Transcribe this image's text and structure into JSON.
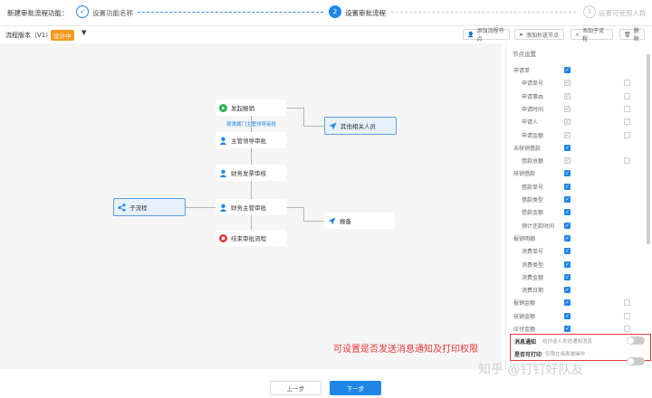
{
  "header": {
    "app_title": "新建审批流程功能：",
    "steps": [
      {
        "num": "✓",
        "label": "设置功能名称"
      },
      {
        "num": "2",
        "label": "设置审批流程"
      },
      {
        "num": "3",
        "label": "设置可使用人群"
      }
    ]
  },
  "toolbar": {
    "version_label": "流程版本（V1）",
    "version_status": "设计中",
    "buttons": [
      "添加流程节点",
      "添加抄送节点",
      "添加子流程",
      "删除"
    ]
  },
  "flow": {
    "nodes": {
      "start": "发起报销",
      "condition": "按隶属门主管领导审批",
      "notify_others": "其他相关人员",
      "supervisor": "主管领导审批",
      "finance_invoice": "财务发票审核",
      "subprocess": "子流程",
      "finance_supervisor": "财务主管审批",
      "report": "报备",
      "end": "结束审批流程"
    }
  },
  "panel": {
    "title": "节点设置",
    "fields": [
      {
        "label": "申请单",
        "indent": false,
        "read": "on",
        "write": "none"
      },
      {
        "label": "申请单号",
        "indent": true,
        "read": "dis",
        "write": "off"
      },
      {
        "label": "申请事由",
        "indent": true,
        "read": "dis",
        "write": "off"
      },
      {
        "label": "申请时间",
        "indent": true,
        "read": "dis",
        "write": "off"
      },
      {
        "label": "申请人",
        "indent": true,
        "read": "dis",
        "write": "off"
      },
      {
        "label": "申请金额",
        "indent": true,
        "read": "dis",
        "write": "off"
      },
      {
        "label": "未核销借款",
        "indent": false,
        "read": "on",
        "write": "none"
      },
      {
        "label": "借款总额",
        "indent": true,
        "read": "dis",
        "write": "off"
      },
      {
        "label": "核销借款",
        "indent": false,
        "read": "on",
        "write": "none"
      },
      {
        "label": "借款单号",
        "indent": true,
        "read": "on",
        "write": "none"
      },
      {
        "label": "借款类型",
        "indent": true,
        "read": "on",
        "write": "none"
      },
      {
        "label": "借款金额",
        "indent": true,
        "read": "on",
        "write": "none"
      },
      {
        "label": "预计还款时间",
        "indent": true,
        "read": "on",
        "write": "none"
      },
      {
        "label": "报销明细",
        "indent": false,
        "read": "on",
        "write": "none"
      },
      {
        "label": "消费单号",
        "indent": true,
        "read": "on",
        "write": "none"
      },
      {
        "label": "消费类型",
        "indent": true,
        "read": "on",
        "write": "none"
      },
      {
        "label": "消费金额",
        "indent": true,
        "read": "on",
        "write": "none"
      },
      {
        "label": "消费日期",
        "indent": true,
        "read": "on",
        "write": "none"
      },
      {
        "label": "报销金额",
        "indent": false,
        "read": "on",
        "write": "off"
      },
      {
        "label": "核销金额",
        "indent": false,
        "read": "on",
        "write": "off"
      },
      {
        "label": "应付金额",
        "indent": false,
        "read": "on",
        "write": "off"
      }
    ],
    "toggles": [
      {
        "label": "消息通知",
        "desc": "给抄送人发送通知消息"
      },
      {
        "label": "是否可打印",
        "desc": "仅限在桌面端操作"
      }
    ]
  },
  "annotation": "可设置是否发送消息通知及打印权限",
  "watermark": "知乎 @钉钉好队友",
  "footer": {
    "prev": "上一步",
    "next": "下一步"
  },
  "colors": {
    "accent": "#1f86e8",
    "warning": "#f39a1d",
    "annotation": "#e53935",
    "start": "#2bb24c",
    "end": "#d9363e"
  }
}
